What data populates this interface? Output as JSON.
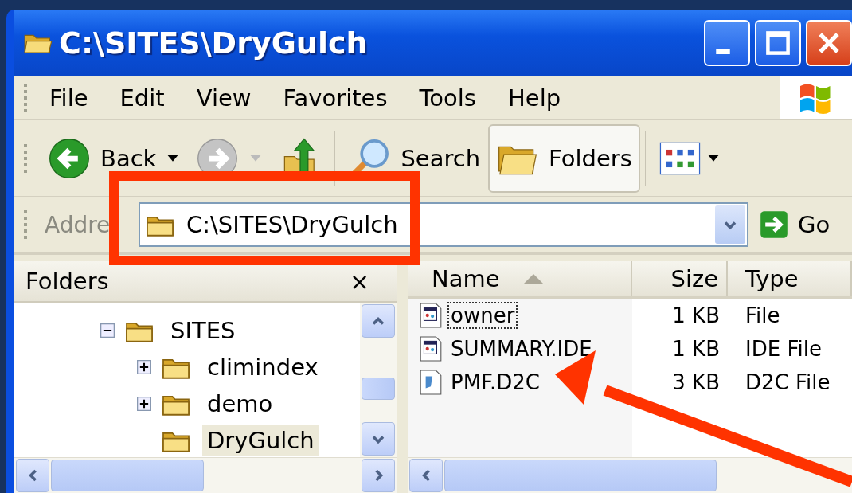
{
  "window": {
    "title": "C:\\SITES\\DryGulch"
  },
  "menu": [
    "File",
    "Edit",
    "View",
    "Favorites",
    "Tools",
    "Help"
  ],
  "toolbar": {
    "back": {
      "label": "Back"
    },
    "forward": {
      "disabled": true
    },
    "search": {
      "label": "Search"
    },
    "folders": {
      "label": "Folders",
      "selected": true
    }
  },
  "address_bar": {
    "label": "Addre",
    "value": "C:\\SITES\\DryGulch",
    "go": "Go"
  },
  "folders_pane": {
    "title": "Folders",
    "close": "×",
    "tree": [
      {
        "name": "SITES",
        "expanded": true,
        "selected": false,
        "children": [
          {
            "name": "climindex",
            "expanded": false,
            "selected": false
          },
          {
            "name": "demo",
            "expanded": false,
            "selected": false
          },
          {
            "name": "DryGulch",
            "selected": true
          }
        ]
      }
    ]
  },
  "file_list": {
    "columns": [
      {
        "label": "Name",
        "sorted": true
      },
      {
        "label": "Size",
        "sorted": false
      },
      {
        "label": "Type",
        "sorted": false
      }
    ],
    "rows": [
      {
        "name": "owner",
        "size": "1 KB",
        "type": "File",
        "kind": "window",
        "focused": true
      },
      {
        "name": "SUMMARY.IDE",
        "size": "1 KB",
        "type": "IDE File",
        "kind": "window",
        "focused": false
      },
      {
        "name": "PMF.D2C",
        "size": "3 KB",
        "type": "D2C File",
        "kind": "data",
        "focused": false
      }
    ]
  }
}
